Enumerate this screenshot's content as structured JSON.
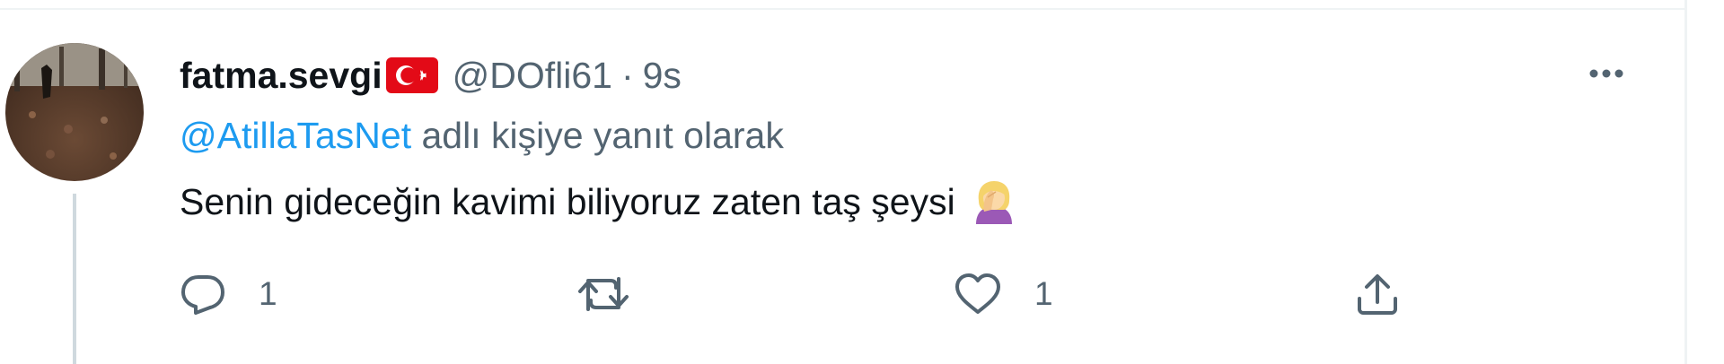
{
  "tweet": {
    "display_name": "fatma.sevgi",
    "flag_icon": "turkey-flag-icon",
    "handle": "@DOfli61",
    "separator": "·",
    "time": "9s",
    "reply_mention": "@AtillaTasNet",
    "reply_suffix": " adlı kişiye yanıt olarak",
    "text": "Senin gideceğin kavimi biliyoruz zaten taş şeysi",
    "emoji_icon": "woman-facepalming-emoji",
    "more_icon": "more-dots-icon"
  },
  "actions": {
    "reply": {
      "icon": "reply-icon",
      "count": "1"
    },
    "retweet": {
      "icon": "retweet-icon",
      "count": ""
    },
    "like": {
      "icon": "heart-icon",
      "count": "1"
    },
    "share": {
      "icon": "share-icon"
    }
  },
  "colors": {
    "text_primary": "#0f1419",
    "text_secondary": "#536471",
    "mention_blue": "#1d9bf0",
    "divider": "#eff3f4",
    "thread_line": "#cfd9de"
  }
}
